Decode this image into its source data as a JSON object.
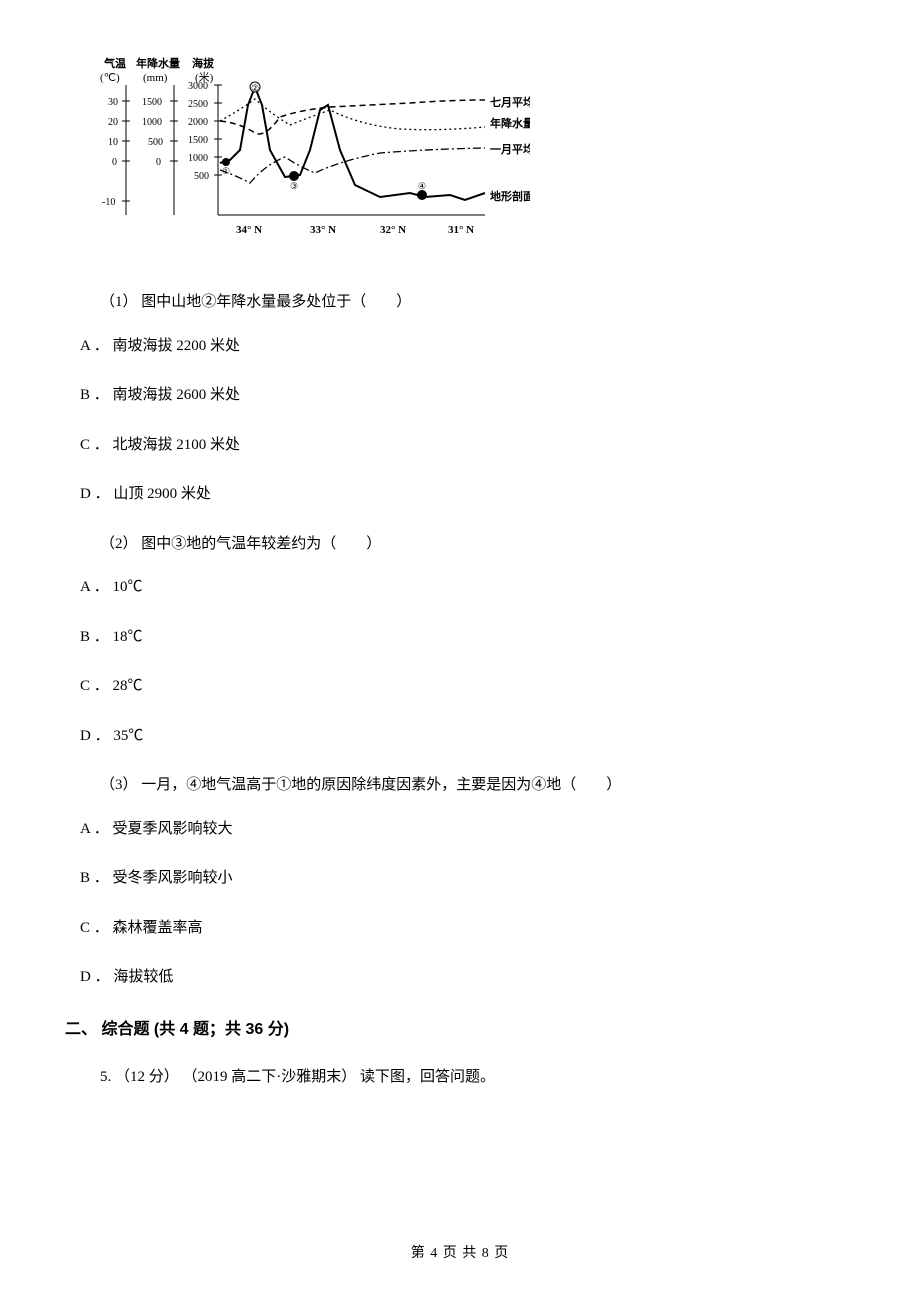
{
  "chart_data": {
    "type": "line",
    "title": "",
    "y_axes": [
      {
        "label": "气温",
        "unit": "(℃)",
        "ticks": [
          -10,
          0,
          10,
          20,
          30
        ]
      },
      {
        "label": "年降水量",
        "unit": "(mm)",
        "ticks": [
          0,
          500,
          1000,
          1500
        ]
      },
      {
        "label": "海拔",
        "unit": "(米)",
        "ticks": [
          500,
          1000,
          1500,
          2000,
          2500,
          3000
        ]
      }
    ],
    "x_axis": {
      "label": "",
      "categories": [
        "34° N",
        "33° N",
        "32° N",
        "31° N"
      ]
    },
    "series": [
      {
        "name": "七月平均气温",
        "approx_values_C": [
          20,
          15,
          22,
          20,
          25,
          26,
          27
        ]
      },
      {
        "name": "年降水量",
        "approx_values_mm": [
          1000,
          1400,
          900,
          1200,
          800,
          750,
          700
        ]
      },
      {
        "name": "一月平均气温",
        "approx_values_C": [
          -5,
          -10,
          0,
          -3,
          5,
          6,
          7
        ]
      },
      {
        "name": "地形剖面",
        "approx_values_m": [
          1000,
          2900,
          700,
          2500,
          400,
          350,
          350
        ]
      }
    ],
    "annotations": [
      "①",
      "②",
      "③",
      "④"
    ],
    "series_labels": {
      "july_temp": "七月平均气温",
      "precip": "年降水量",
      "jan_temp": "一月平均气温",
      "terrain": "地形剖面"
    }
  },
  "q1": {
    "stem": "（1） 图中山地②年降水量最多处位于（　　）",
    "options": {
      "A": "A ．  南坡海拔 2200 米处",
      "B": "B ．  南坡海拔 2600 米处",
      "C": "C ．  北坡海拔 2100 米处",
      "D": "D ．  山顶 2900 米处"
    }
  },
  "q2": {
    "stem": "（2） 图中③地的气温年较差约为（　　）",
    "options": {
      "A": "A ．  10℃",
      "B": "B ．  18℃",
      "C": "C ．  28℃",
      "D": "D ．  35℃"
    }
  },
  "q3": {
    "stem": "（3） 一月，④地气温高于①地的原因除纬度因素外，主要是因为④地（　　）",
    "options": {
      "A": "A ．  受夏季风影响较大",
      "B": "B ．  受冬季风影响较小",
      "C": "C ．  森林覆盖率高",
      "D": "D ．  海拔较低"
    }
  },
  "section2": {
    "heading": "二、 综合题 (共 4 题；共 36 分)"
  },
  "q5": {
    "stem": "5.  （12 分） （2019 高二下·沙雅期末） 读下图，回答问题。"
  },
  "footer": {
    "text": "第 4 页 共 8 页"
  }
}
